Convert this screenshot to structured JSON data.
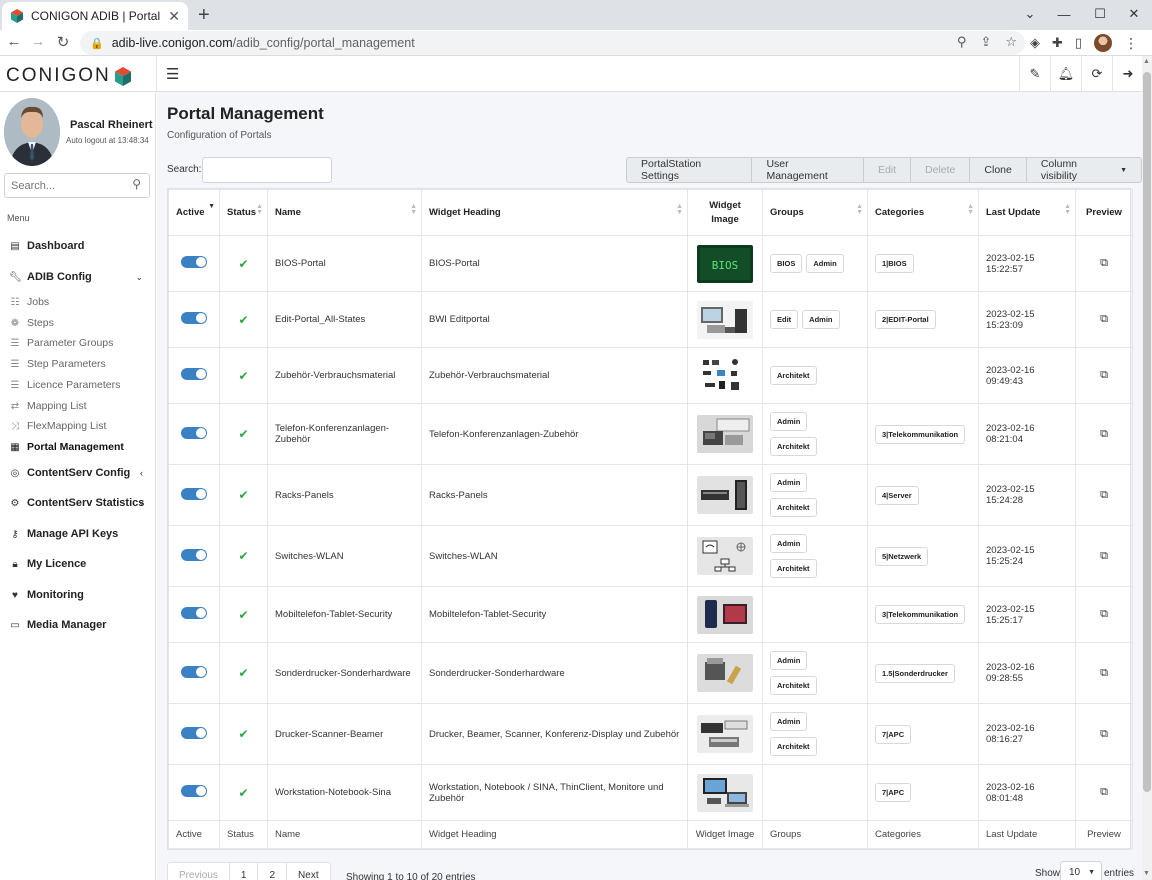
{
  "browser": {
    "tab_title": "CONIGON ADIB | Portal Managem",
    "url_host": "adib-live.conigon.com",
    "url_path": "/adib_config/portal_management"
  },
  "header": {
    "logo_text": "CONIGON"
  },
  "profile": {
    "name": "Pascal Rheinert",
    "auto_logout": "Auto logout at 13:48:34"
  },
  "sidebar": {
    "search_placeholder": "Search...",
    "menu_heading": "Menu",
    "items": [
      {
        "label": "Dashboard",
        "icon": "chart-icon"
      },
      {
        "label": "ADIB Config",
        "icon": "wrench-icon"
      },
      {
        "label": "Jobs",
        "icon": "list-icon"
      },
      {
        "label": "Steps",
        "icon": "paw-icon"
      },
      {
        "label": "Parameter Groups",
        "icon": "list-icon"
      },
      {
        "label": "Step Parameters",
        "icon": "list-icon"
      },
      {
        "label": "Licence Parameters",
        "icon": "list-icon"
      },
      {
        "label": "Mapping List",
        "icon": "exchange-icon"
      },
      {
        "label": "FlexMapping List",
        "icon": "shuffle-icon"
      },
      {
        "label": "Portal Management",
        "icon": "grid-icon"
      },
      {
        "label": "ContentServ Config",
        "icon": "circle-icon"
      },
      {
        "label": "ContentServ Statistics",
        "icon": "gear-icon"
      },
      {
        "label": "Manage API Keys",
        "icon": "key-icon"
      },
      {
        "label": "My Licence",
        "icon": "lock-icon"
      },
      {
        "label": "Monitoring",
        "icon": "heart-pulse-icon"
      },
      {
        "label": "Media Manager",
        "icon": "file-icon"
      }
    ]
  },
  "main": {
    "title": "Portal Management",
    "subtitle": "Configuration of Portals",
    "search_label": "Search:",
    "buttons": [
      "PortalStation Settings",
      "User Management",
      "Edit",
      "Delete",
      "Clone",
      "Column visibility"
    ],
    "columns": [
      "Active",
      "Status",
      "Name",
      "Widget Heading",
      "Widget Image",
      "Groups",
      "Categories",
      "Last Update",
      "Preview"
    ],
    "footer_columns": [
      "Active",
      "Status",
      "Name",
      "Widget Heading",
      "Widget Image",
      "Groups",
      "Categories",
      "Last Update",
      "Preview"
    ],
    "rows": [
      {
        "name": "BIOS-Portal",
        "heading": "BIOS-Portal",
        "image": "bios-thumbnail",
        "groups": [
          "BIOS",
          "Admin"
        ],
        "categories": [
          "1|BIOS"
        ],
        "date": "2023-02-15",
        "time": "15:22:57"
      },
      {
        "name": "Edit-Portal_All-States",
        "heading": "BWI Editportal",
        "image": "workstation-thumbnail",
        "groups": [
          "Edit",
          "Admin"
        ],
        "categories": [
          "2|EDIT-Portal"
        ],
        "date": "2023-02-15",
        "time": "15:23:09"
      },
      {
        "name": "Zubehör-Verbrauchsmaterial",
        "heading": "Zubehör-Verbrauchsmaterial",
        "image": "accessories-thumbnail",
        "groups": [
          "Architekt"
        ],
        "categories": [],
        "date": "2023-02-16",
        "time": "09:49:43"
      },
      {
        "name": "Telefon-Konferenzanlagen-Zubehör",
        "heading": "Telefon-Konferenzanlagen-Zubehör",
        "image": "phone-thumbnail",
        "groups": [
          "Admin",
          "Architekt"
        ],
        "categories": [
          "3|Telekommunikation"
        ],
        "date": "2023-02-16",
        "time": "08:21:04"
      },
      {
        "name": "Racks-Panels",
        "heading": "Racks-Panels",
        "image": "rack-thumbnail",
        "groups": [
          "Admin",
          "Architekt"
        ],
        "categories": [
          "4|Server"
        ],
        "date": "2023-02-15",
        "time": "15:24:28"
      },
      {
        "name": "Switches-WLAN",
        "heading": "Switches-WLAN",
        "image": "network-thumbnail",
        "groups": [
          "Admin",
          "Architekt"
        ],
        "categories": [
          "5|Netzwerk"
        ],
        "date": "2023-02-15",
        "time": "15:25:24"
      },
      {
        "name": "Mobiltelefon-Tablet-Security",
        "heading": "Mobiltelefon-Tablet-Security",
        "image": "mobile-thumbnail",
        "groups": [],
        "categories": [
          "3|Telekommunikation"
        ],
        "date": "2023-02-15",
        "time": "15:25:17"
      },
      {
        "name": "Sonderdrucker-Sonderhardware",
        "heading": "Sonderdrucker-Sonderhardware",
        "image": "printer-special-thumbnail",
        "groups": [
          "Admin",
          "Architekt"
        ],
        "categories": [
          "1.5|Sonderdrucker"
        ],
        "date": "2023-02-16",
        "time": "09:28:55"
      },
      {
        "name": "Drucker-Scanner-Beamer",
        "heading": "Drucker, Beamer, Scanner, Konferenz-Display und Zubehör",
        "image": "printer-thumbnail",
        "groups": [
          "Admin",
          "Architekt"
        ],
        "categories": [
          "7|APC"
        ],
        "date": "2023-02-16",
        "time": "08:16:27"
      },
      {
        "name": "Workstation-Notebook-Sina",
        "heading": "Workstation, Notebook / SINA, ThinClient, Monitore und Zubehör",
        "image": "notebook-thumbnail",
        "groups": [],
        "categories": [
          "7|APC"
        ],
        "date": "2023-02-16",
        "time": "08:01:48"
      }
    ],
    "pagination": {
      "previous": "Previous",
      "pages": [
        "1",
        "2"
      ],
      "next": "Next"
    },
    "showing": "Showing 1 to 10 of 20 entries",
    "show_label": "Show",
    "page_size": "10",
    "entries_label": "entries"
  },
  "colors": {
    "accent": "#3b82c4",
    "status_ok": "#28a745",
    "content_bg": "#f4f6f9"
  }
}
